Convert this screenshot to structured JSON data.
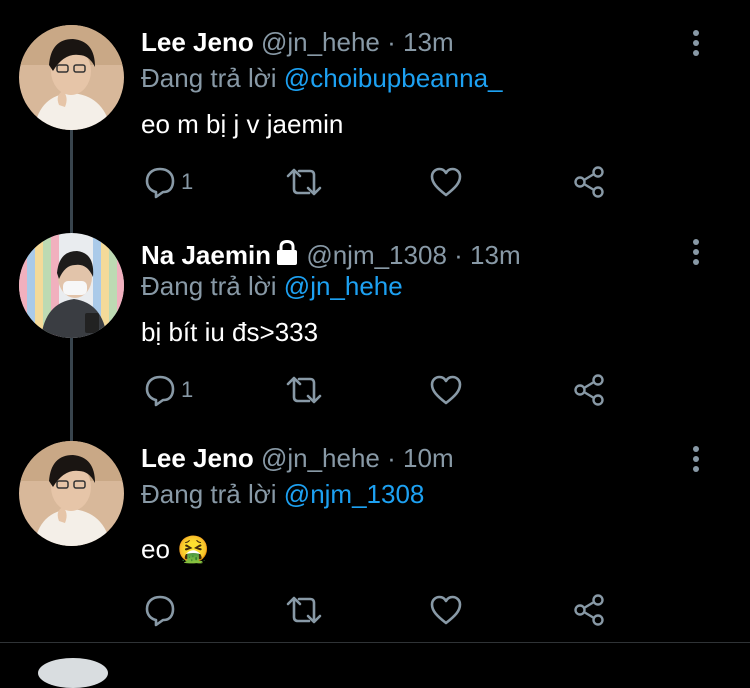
{
  "tweets": [
    {
      "name": "Lee Jeno",
      "handle": "@jn_hehe",
      "separator": "·",
      "time": "13m",
      "reply_prefix": "Đang trả lời",
      "reply_to": "@choibupbeanna_",
      "text": "eo m bị j v jaemin",
      "reply_count": "1",
      "locked": false
    },
    {
      "name": "Na Jaemin",
      "handle": "@njm_1308",
      "separator": "·",
      "time": "13m",
      "reply_prefix": "Đang trả lời",
      "reply_to": "@jn_hehe",
      "text": "bị bít iu đs>333",
      "reply_count": "1",
      "locked": true
    },
    {
      "name": "Lee Jeno",
      "handle": "@jn_hehe",
      "separator": "·",
      "time": "10m",
      "reply_prefix": "Đang trả lời",
      "reply_to": "@njm_1308",
      "text": "eo 🤮",
      "reply_count": "",
      "locked": false
    }
  ],
  "icons": {
    "reply": "reply-icon",
    "retweet": "retweet-icon",
    "like": "heart-icon",
    "share": "share-icon",
    "more": "more-options-icon",
    "lock": "lock-icon"
  },
  "colors": {
    "background": "#000000",
    "name": "#ffffff",
    "meta": "#8899a6",
    "mention": "#1da1f2",
    "thread_line": "#38444d"
  }
}
